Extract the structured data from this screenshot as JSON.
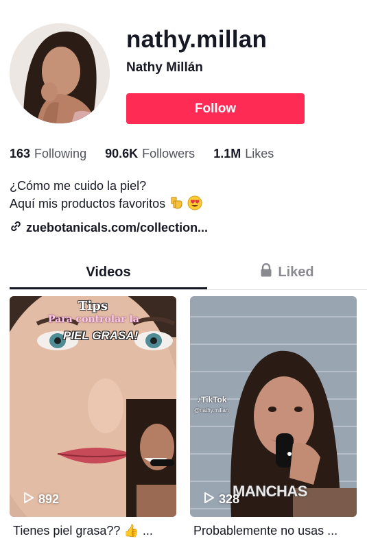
{
  "profile": {
    "username": "nathy.millan",
    "display_name": "Nathy Millán",
    "follow_label": "Follow"
  },
  "stats": {
    "following_count": "163",
    "following_label": "Following",
    "followers_count": "90.6K",
    "followers_label": "Followers",
    "likes_count": "1.1M",
    "likes_label": "Likes"
  },
  "bio": {
    "line1": "¿Cómo me cuido la piel?",
    "line2": "Aquí mis productos favoritos"
  },
  "link": {
    "text": "zuebotanicals.com/collection..."
  },
  "tabs": {
    "videos": "Videos",
    "liked": "Liked"
  },
  "videos": [
    {
      "views": "892",
      "caption": "Tienes piel grasa?? 👍 ...",
      "overlay_title": "Tips",
      "overlay_sub": "Para controlar la",
      "overlay_main": "PIEL GRASA!"
    },
    {
      "views": "328",
      "caption": "Probablemente no usas ...",
      "watermark_brand": "TikTok",
      "watermark_handle": "@nathy.millan",
      "overlay_main": "MANCHAS"
    }
  ],
  "colors": {
    "follow_button": "#fe2c55",
    "text_primary": "#161823"
  }
}
